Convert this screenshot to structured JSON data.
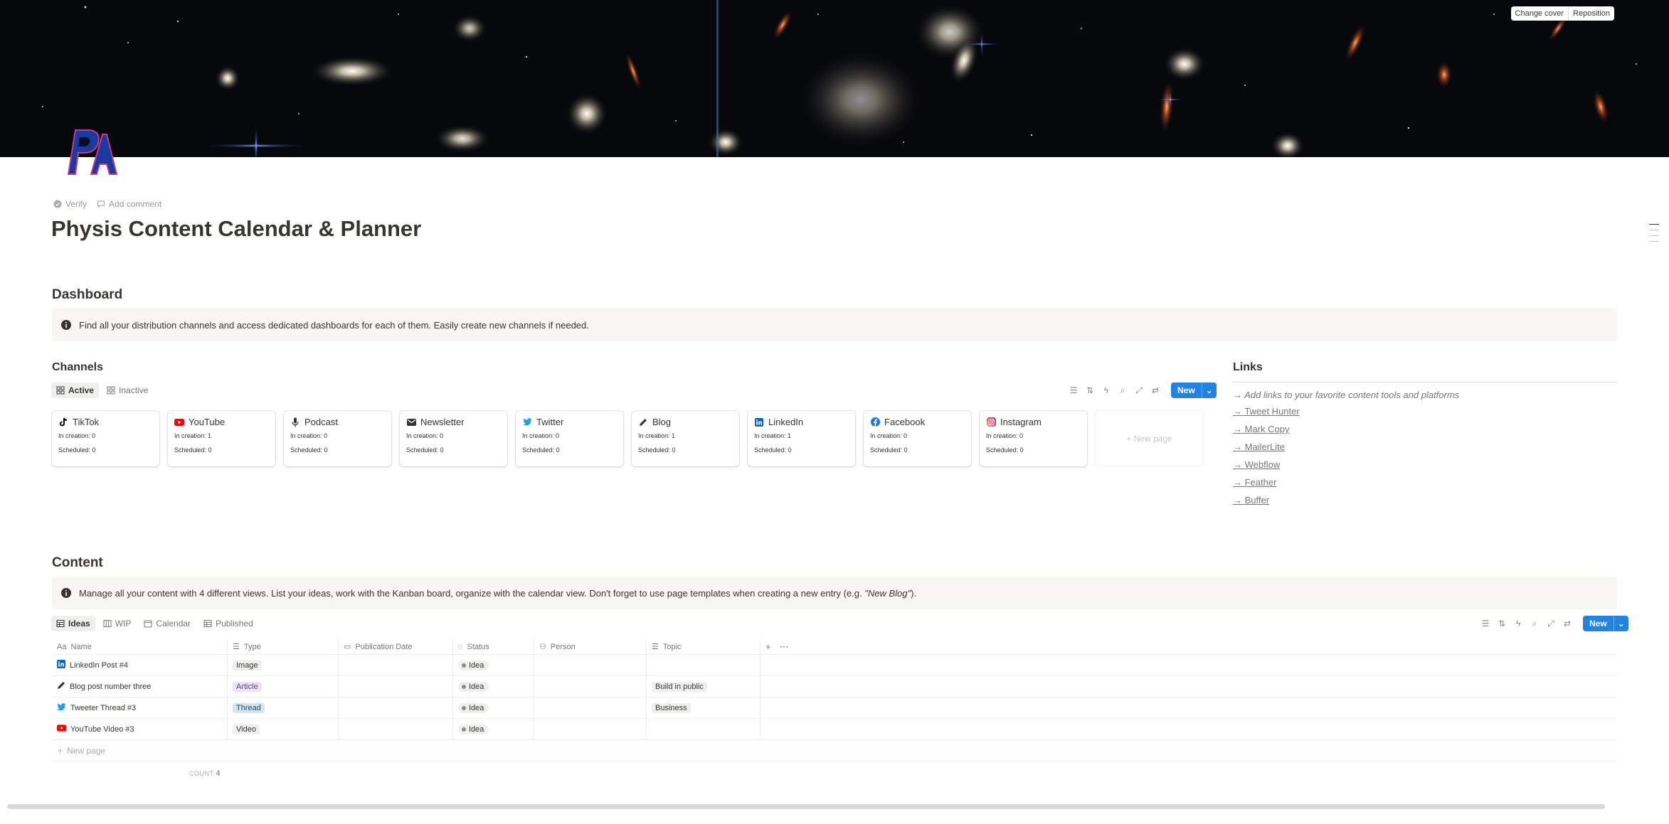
{
  "cover": {
    "change_cover": "Change cover",
    "reposition": "Reposition"
  },
  "meta": {
    "verify": "Verify",
    "add_comment": "Add comment"
  },
  "page_title": "Physis Content Calendar & Planner",
  "dashboard": {
    "heading": "Dashboard",
    "callout": "Find all your distribution channels and access dedicated dashboards for each of them. Easily create new channels if needed."
  },
  "channels": {
    "heading": "Channels",
    "tabs": [
      {
        "label": "Active"
      },
      {
        "label": "Inactive"
      }
    ],
    "new_label": "New",
    "cards": [
      {
        "name": "TikTok",
        "in_creation": "In creation: 0",
        "scheduled": "Scheduled: 0",
        "icon": "tiktok-icon"
      },
      {
        "name": "YouTube",
        "in_creation": "In creation: 1",
        "scheduled": "Scheduled: 0",
        "icon": "youtube-icon"
      },
      {
        "name": "Podcast",
        "in_creation": "In creation: 0",
        "scheduled": "Scheduled: 0",
        "icon": "microphone-icon"
      },
      {
        "name": "Newsletter",
        "in_creation": "In creation: 0",
        "scheduled": "Scheduled: 0",
        "icon": "envelope-icon"
      },
      {
        "name": "Twitter",
        "in_creation": "In creation: 0",
        "scheduled": "Scheduled: 0",
        "icon": "twitter-icon"
      },
      {
        "name": "Blog",
        "in_creation": "In creation: 1",
        "scheduled": "Scheduled: 0",
        "icon": "pencil-icon"
      },
      {
        "name": "LinkedIn",
        "in_creation": "In creation: 1",
        "scheduled": "Scheduled: 0",
        "icon": "linkedin-icon"
      },
      {
        "name": "Facebook",
        "in_creation": "In creation: 0",
        "scheduled": "Scheduled: 0",
        "icon": "facebook-icon"
      },
      {
        "name": "Instagram",
        "in_creation": "In creation: 0",
        "scheduled": "Scheduled: 0",
        "icon": "instagram-icon"
      }
    ],
    "new_page": "+ New page"
  },
  "links": {
    "heading": "Links",
    "hint": "→ Add links to your favorite content tools and platforms",
    "items": [
      "→ Tweet Hunter",
      "→ Mark Copy",
      "→ MailerLite",
      "→ Webflow",
      "→ Feather",
      "→ Buffer"
    ]
  },
  "content": {
    "heading": "Content",
    "callout": "Manage all your content with 4 different views. List your ideas, work with the Kanban board, organize with the calendar view. Don't forget to use page templates when creating a new entry (e.g. ",
    "callout_em": "\"New Blog\"",
    "callout_end": ").",
    "tabs": [
      {
        "label": "Ideas"
      },
      {
        "label": "WIP"
      },
      {
        "label": "Calendar"
      },
      {
        "label": "Published"
      }
    ],
    "new_label": "New",
    "columns": [
      "Name",
      "Type",
      "Publication Date",
      "Status",
      "Person",
      "Topic"
    ],
    "rows": [
      {
        "name": "LinkedIn Post #4",
        "icon": "linkedin-icon",
        "type": "Image",
        "type_color": "gray",
        "status": "Idea",
        "topic": ""
      },
      {
        "name": "Blog post number three",
        "icon": "pencil-icon",
        "type": "Article",
        "type_color": "purple",
        "status": "Idea",
        "topic": "Build in public"
      },
      {
        "name": "Tweeter Thread #3",
        "icon": "twitter-icon",
        "type": "Thread",
        "type_color": "blue",
        "status": "Idea",
        "topic": "Business"
      },
      {
        "name": "YouTube Video #3",
        "icon": "youtube-icon",
        "type": "Video",
        "type_color": "gray",
        "status": "Idea",
        "topic": ""
      }
    ],
    "new_page": "New page",
    "count_label": "COUNT",
    "count_value": "4"
  },
  "colors": {
    "accent": "#2383e2",
    "youtube": "#ff0000",
    "twitter": "#1da1f2",
    "linkedin": "#0a66c2",
    "facebook": "#1877f2"
  }
}
